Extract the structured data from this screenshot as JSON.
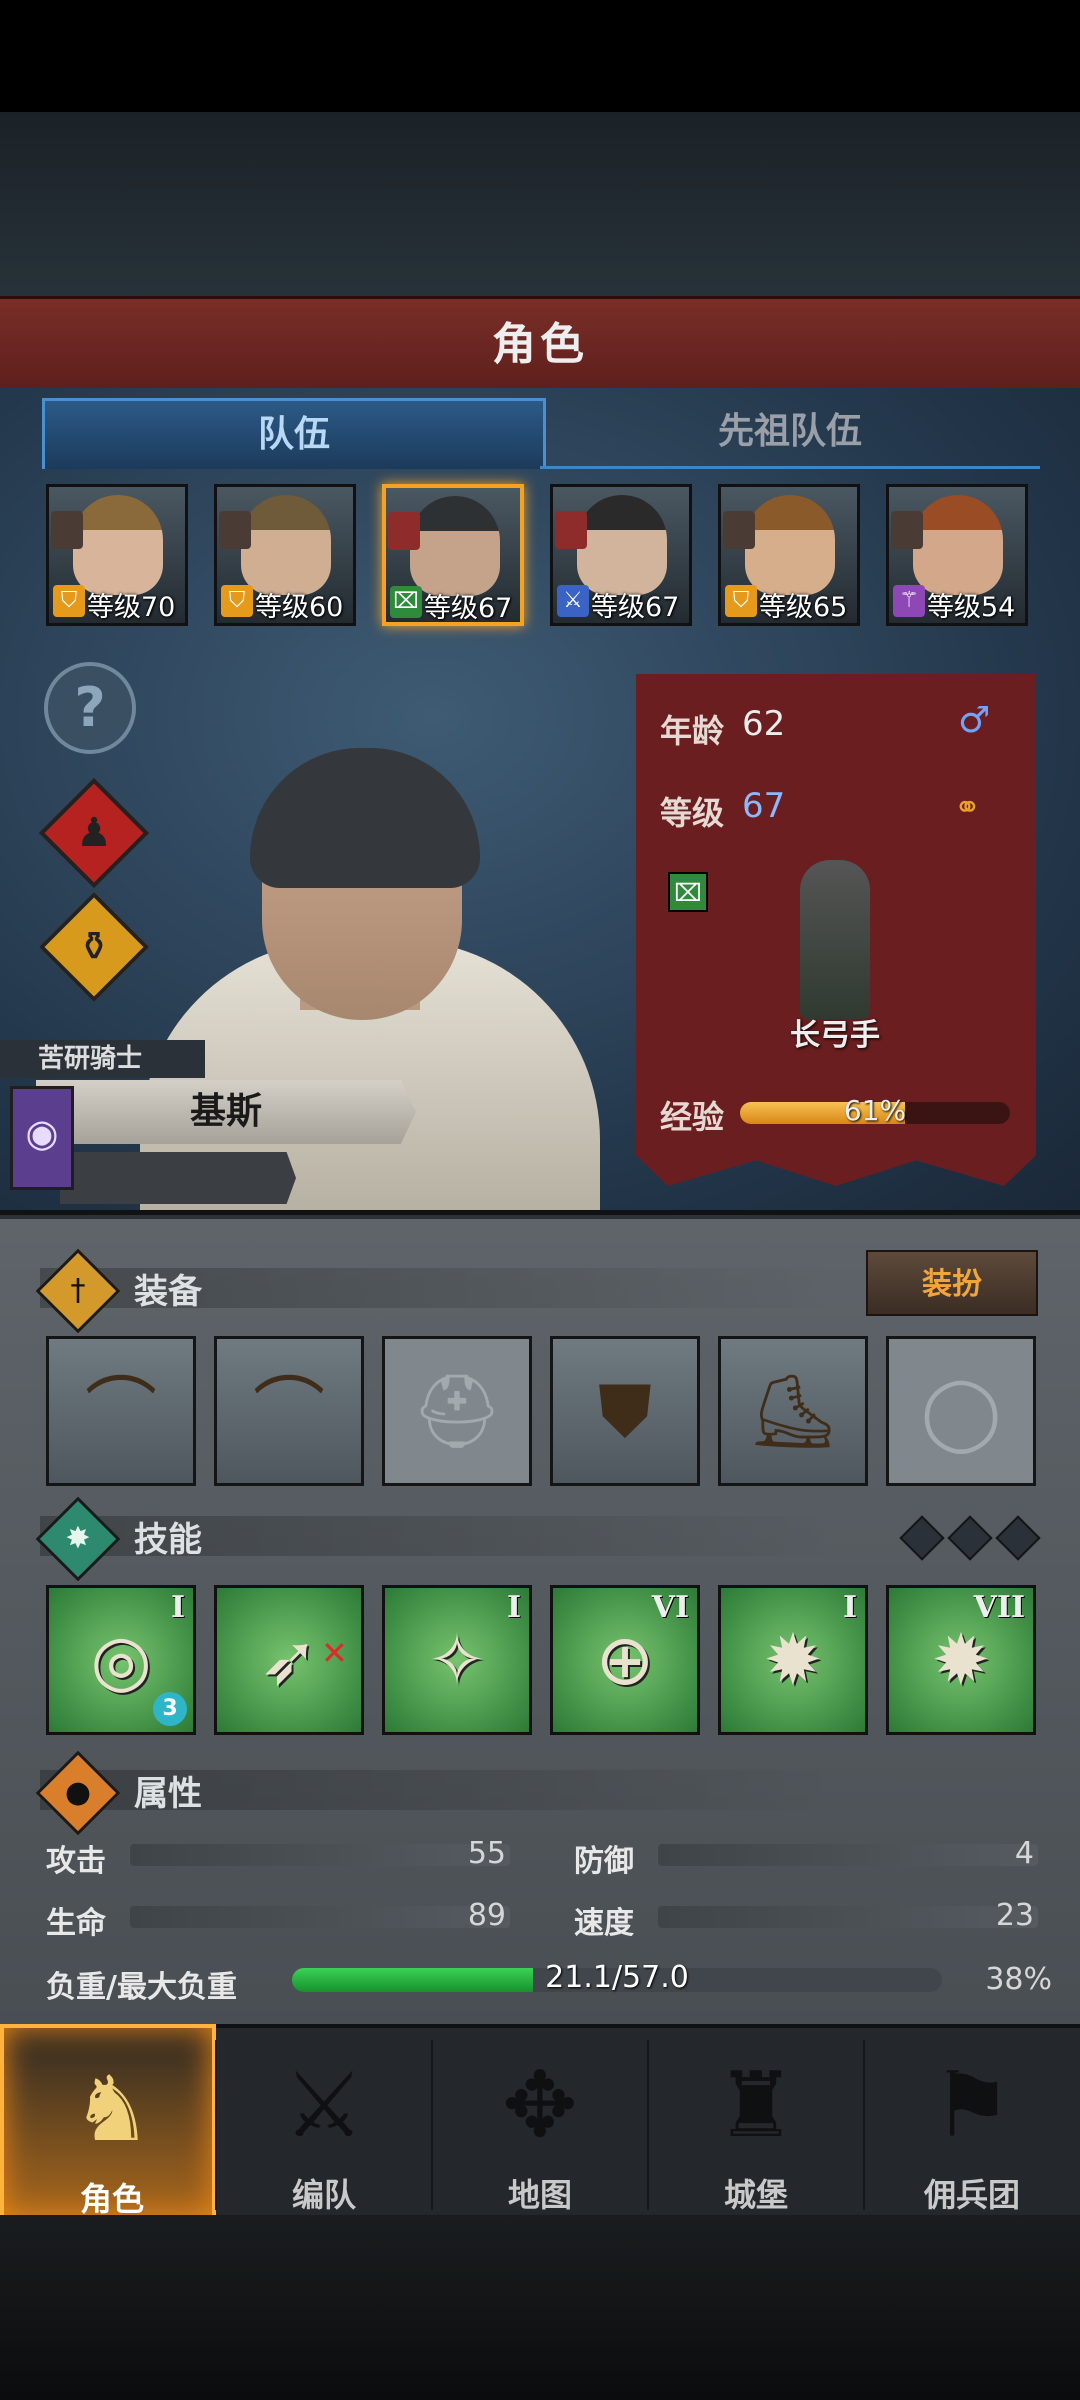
{
  "header": {
    "title": "角色"
  },
  "tabs": [
    {
      "label": "队伍",
      "active": true
    },
    {
      "label": "先祖队伍",
      "active": false
    }
  ],
  "heroes": [
    {
      "level": "等级70",
      "class_icon": "shield-star-icon",
      "class_color": "#e59a1c",
      "hair": "#8a6a3a",
      "skin": "#d8b59a",
      "badge": "dark"
    },
    {
      "level": "等级60",
      "class_icon": "shield-icon",
      "class_color": "#e59a1c",
      "hair": "#6f5a3a",
      "skin": "#cfae92",
      "badge": "dark"
    },
    {
      "level": "等级67",
      "class_icon": "archer-icon",
      "class_color": "#2f8a3c",
      "hair": "#2e3134",
      "skin": "#c4a38a",
      "badge": "red",
      "selected": true
    },
    {
      "level": "等级67",
      "class_icon": "sword-icon",
      "class_color": "#3a63c4",
      "hair": "#2a2a2a",
      "skin": "#d2b49c",
      "badge": "red"
    },
    {
      "level": "等级65",
      "class_icon": "shield-icon",
      "class_color": "#e59a1c",
      "hair": "#8a5a2a",
      "skin": "#d7ae8c",
      "badge": "dark"
    },
    {
      "level": "等级54",
      "class_icon": "staff-icon",
      "class_color": "#8e48b5",
      "hair": "#9a4c24",
      "skin": "#d3a88a",
      "badge": "dark"
    }
  ],
  "character": {
    "title": "苦研骑士",
    "name": "基斯",
    "age_label": "年龄",
    "age": "62",
    "level_label": "等级",
    "level": "67",
    "class_name": "长弓手",
    "exp_label": "经验",
    "exp_text": "61%",
    "exp_fraction": 0.61
  },
  "equipment": {
    "title": "装备",
    "dress_button": "装扮",
    "slots": [
      {
        "icon": "longbow-icon",
        "filled": true
      },
      {
        "icon": "longbow-icon",
        "filled": true
      },
      {
        "icon": "helmet-icon",
        "filled": false
      },
      {
        "icon": "tunic-icon",
        "filled": true
      },
      {
        "icon": "boots-icon",
        "filled": true
      },
      {
        "icon": "ring-icon",
        "filled": false
      }
    ]
  },
  "skills": {
    "title": "技能",
    "items": [
      {
        "icon": "target-arrow-icon",
        "tier": "I",
        "badge": "3"
      },
      {
        "icon": "rabbit-bow-icon",
        "tier": "",
        "mark": "x"
      },
      {
        "icon": "gem-burst-icon",
        "tier": "I"
      },
      {
        "icon": "crosshair-icon",
        "tier": "VI"
      },
      {
        "icon": "burst-icon",
        "tier": "I"
      },
      {
        "icon": "burst-icon",
        "tier": "VII"
      }
    ]
  },
  "attributes": {
    "title": "属性",
    "attack_label": "攻击",
    "attack": "55",
    "defense_label": "防御",
    "defense": "4",
    "hp_label": "生命",
    "hp": "89",
    "speed_label": "速度",
    "speed": "23",
    "load_label": "负重/最大负重",
    "load_text": "21.1/57.0",
    "load_percent": "38%",
    "load_fraction": 0.37
  },
  "nav": [
    {
      "label": "角色",
      "icon": "knight-icon",
      "active": true
    },
    {
      "label": "编队",
      "icon": "formation-icon",
      "active": false
    },
    {
      "label": "地图",
      "icon": "compass-map-icon",
      "active": false
    },
    {
      "label": "城堡",
      "icon": "castle-icon",
      "active": false
    },
    {
      "label": "佣兵团",
      "icon": "mercenary-icon",
      "active": false
    }
  ]
}
